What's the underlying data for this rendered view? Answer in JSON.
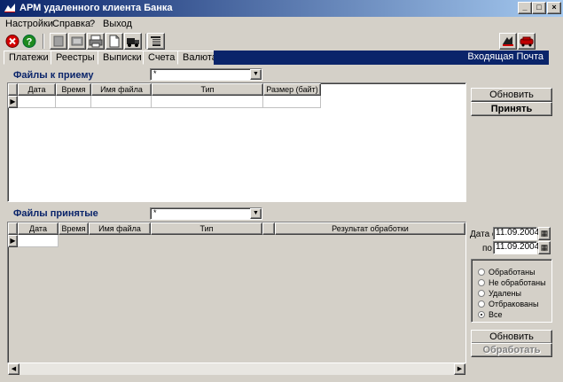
{
  "window": {
    "title": "АРМ удаленного клиента Банка",
    "controls": [
      "_",
      "□",
      "×"
    ]
  },
  "menu": {
    "items": [
      "Настройки",
      "Справка",
      "?",
      "Выход"
    ]
  },
  "tabs": {
    "items": [
      "Платежи",
      "Реестры",
      "Выписки",
      "Счета",
      "Валюта"
    ],
    "right_label": "Входящая Почта"
  },
  "incoming": {
    "label": "Файлы к приему",
    "filter_value": "*",
    "columns": [
      "Дата",
      "Время",
      "Имя файла",
      "Тип",
      "Размер (байт)"
    ],
    "refresh_button": "Обновить",
    "accept_button": "Принять"
  },
  "accepted": {
    "label": "Файлы принятые",
    "filter_value": "*",
    "columns": [
      "Дата",
      "Время",
      "Имя файла",
      "Тип",
      "",
      "Результат обработки"
    ],
    "date_from_label": "Дата с",
    "date_from": "11.09.2004",
    "date_to_label": "по",
    "date_to": "11.09.2004",
    "filter_options": [
      "Обработаны",
      "Не обработаны",
      "Удалены",
      "Отбракованы",
      "Все"
    ],
    "selected_option": "Все",
    "refresh_button": "Обновить",
    "process_button": "Обработать"
  },
  "colors": {
    "title_start": "#0a246a",
    "title_end": "#a6caf0",
    "face": "#d4d0c8",
    "section_text": "#0a246a"
  }
}
